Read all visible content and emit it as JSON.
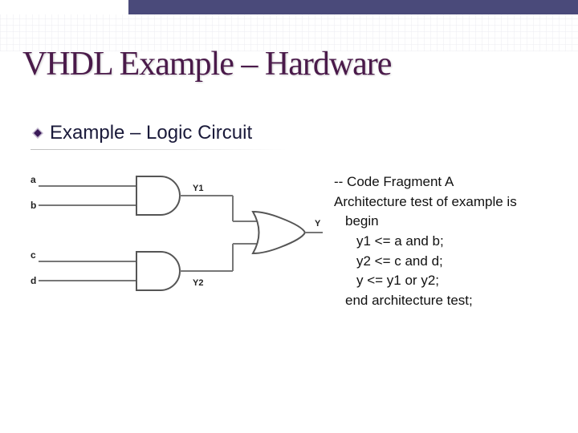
{
  "header": {
    "title": "VHDL Example – Hardware"
  },
  "bullet": {
    "text": "Example – Logic Circuit"
  },
  "circuit": {
    "inputs": {
      "a": "a",
      "b": "b",
      "c": "c",
      "d": "d"
    },
    "gates": {
      "and1_out": "Y1",
      "and2_out": "Y2",
      "or_out": "Y"
    }
  },
  "code": {
    "l1": "--  Code Fragment A",
    "l2": "Architecture test of example is",
    "l3": "begin",
    "l4": "y1 <= a and b;",
    "l5": "y2 <= c and d;",
    "l6": "y   <= y1 or y2;",
    "l7": "end architecture test;"
  }
}
